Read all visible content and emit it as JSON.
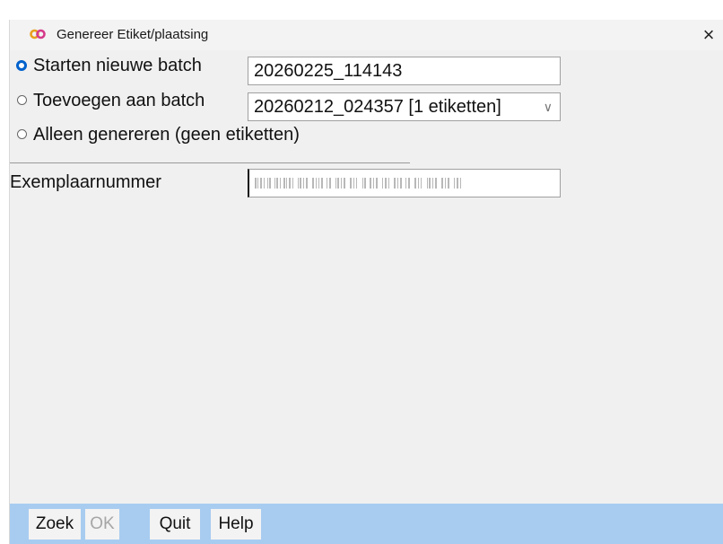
{
  "window": {
    "title": "Genereer Etiket/plaatsing",
    "close_glyph": "×",
    "icon": "app-logo-icon"
  },
  "options": [
    {
      "label": "Starten nieuwe batch",
      "checked": true,
      "value": "20260225_114143"
    },
    {
      "label": "Toevoegen aan batch",
      "checked": false,
      "value": "20260212_024357 [1 etiketten]"
    },
    {
      "label": "Alleen genereren (geen etiketten)",
      "checked": false
    }
  ],
  "exemplaar": {
    "label": "Exemplaarnummer",
    "value_icon": "barcode-placeholder-icon"
  },
  "buttons": {
    "zoek": "Zoek",
    "ok": "OK",
    "quit": "Quit",
    "help": "Help"
  },
  "colors": {
    "accent": "#0061cc",
    "button_bar": "#a8ccf0"
  }
}
